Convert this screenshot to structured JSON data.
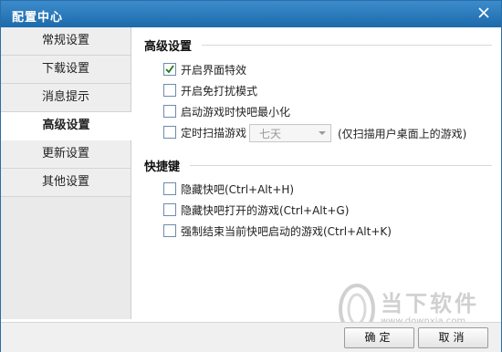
{
  "window": {
    "title": "配置中心"
  },
  "sidebar": {
    "items": [
      {
        "label": "常规设置",
        "active": false
      },
      {
        "label": "下载设置",
        "active": false
      },
      {
        "label": "消息提示",
        "active": false
      },
      {
        "label": "高级设置",
        "active": true
      },
      {
        "label": "更新设置",
        "active": false
      },
      {
        "label": "其他设置",
        "active": false
      }
    ]
  },
  "advanced": {
    "title": "高级设置",
    "options": [
      {
        "label": "开启界面特效",
        "checked": true
      },
      {
        "label": "开启免打扰模式",
        "checked": false
      },
      {
        "label": "启动游戏时快吧最小化",
        "checked": false
      },
      {
        "label": "定时扫描游戏",
        "checked": false
      }
    ],
    "scan_interval": "七天",
    "scan_note": "(仅扫描用户桌面上的游戏)"
  },
  "hotkeys": {
    "title": "快捷键",
    "options": [
      {
        "label": "隐藏快吧(Ctrl+Alt+H)",
        "checked": false
      },
      {
        "label": "隐藏快吧打开的游戏(Ctrl+Alt+G)",
        "checked": false
      },
      {
        "label": "强制结束当前快吧启动的游戏(Ctrl+Alt+K)",
        "checked": false
      }
    ]
  },
  "footer": {
    "ok_label": "确定",
    "cancel_label": "取消"
  },
  "watermark": {
    "text": "当下软件园",
    "url": "www.downxia.com"
  },
  "colors": {
    "titlebar": "#2a7bbd",
    "check": "#1a7a1a"
  }
}
